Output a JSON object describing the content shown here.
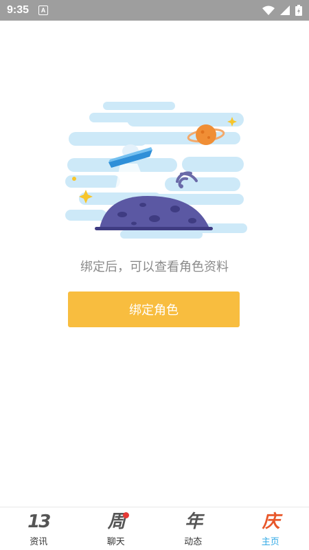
{
  "status_bar": {
    "time": "9:35",
    "notification_icon": "A"
  },
  "main": {
    "message": "绑定后，可以查看角色资料",
    "bind_button_label": "绑定角色"
  },
  "tabs": [
    {
      "icon_text": "13",
      "label": "资讯",
      "active": false,
      "badge": false
    },
    {
      "icon_text": "周",
      "label": "聊天",
      "active": false,
      "badge": true
    },
    {
      "icon_text": "年",
      "label": "动态",
      "active": false,
      "badge": false
    },
    {
      "icon_text": "庆",
      "label": "主页",
      "active": true,
      "badge": false
    }
  ],
  "colors": {
    "button": "#f8bd3f",
    "active_tab_label": "#31a9e6",
    "active_tab_icon": "#e8572a",
    "badge": "#e53935"
  }
}
